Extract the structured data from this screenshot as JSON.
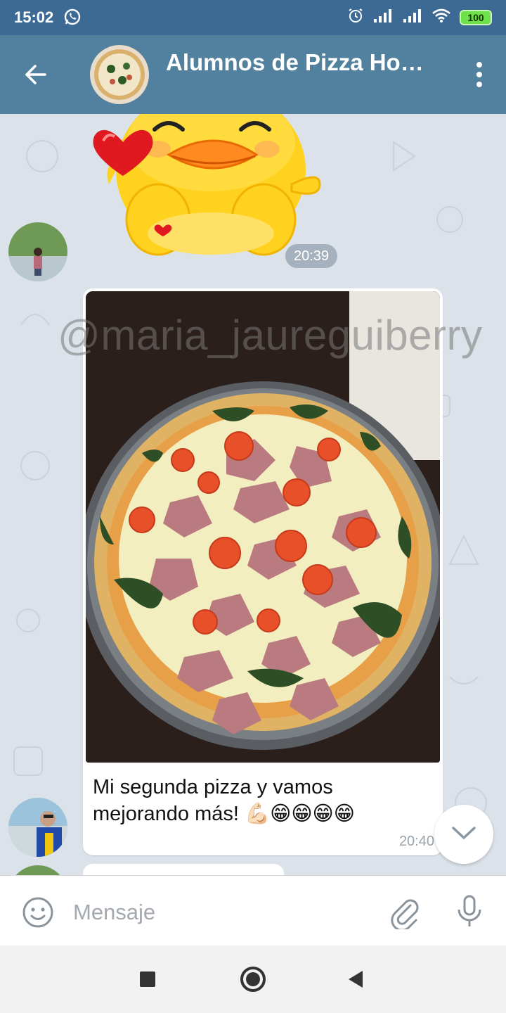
{
  "status_bar": {
    "time": "15:02",
    "battery": "100",
    "icons": [
      "whatsapp-icon",
      "alarm-icon",
      "signal-icon",
      "signal-icon",
      "wifi-icon",
      "battery-icon"
    ]
  },
  "header": {
    "title": "Alumnos de Pizza Ho…",
    "icons": [
      "back-arrow-icon",
      "more-vert-icon"
    ]
  },
  "messages": [
    {
      "type": "sticker",
      "time": "20:39"
    },
    {
      "type": "photo",
      "watermark": "@maria_jaureguiberry",
      "caption_line1": "Mi segunda pizza y vamos",
      "caption_line2": "mejorando más! 💪🏻😁😁😁😁",
      "time": "20:40"
    }
  ],
  "input": {
    "placeholder": "Mensaje",
    "icons": [
      "emoji-icon",
      "attach-icon",
      "mic-icon"
    ]
  },
  "colors": {
    "status_bar": "#3d6a94",
    "header": "#52809f",
    "chat_bg": "#dbe2e9",
    "bubble": "#ffffff"
  }
}
